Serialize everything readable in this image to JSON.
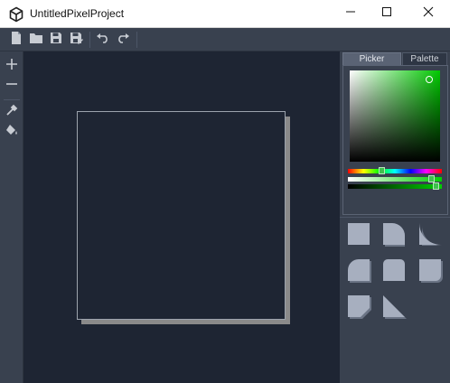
{
  "window": {
    "title": "UntitledPixelProject",
    "app_icon": "unity-logo-icon",
    "controls": [
      "minimize-icon",
      "maximize-icon",
      "close-icon"
    ]
  },
  "toolbar": {
    "buttons": [
      "new-file-icon",
      "open-folder-icon",
      "save-icon",
      "save-as-icon",
      "undo-icon",
      "redo-icon"
    ]
  },
  "left_tools": {
    "buttons": [
      "zoom-in-icon",
      "zoom-out-icon",
      "eyedropper-icon",
      "paint-bucket-icon"
    ]
  },
  "color_panel": {
    "tabs": [
      {
        "label": "Picker",
        "selected": true
      },
      {
        "label": "Palette",
        "selected": false
      }
    ],
    "current_color": "#00c800",
    "hue_slider_fraction": 0.36,
    "saturation_slider_fraction": 0.9,
    "value_slider_fraction": 0.9
  },
  "brush_shapes": [
    "square-shape",
    "rounded-top-right-shape",
    "concave-corner-shape",
    "rounded-top-left-shape",
    "small-rounded-shape",
    "rounded-bottom-right-shape",
    "cut-bottom-right-shape",
    "triangle-shape"
  ],
  "colors": {
    "titlebar_bg": "#ffffff",
    "toolbar_bg": "#39414f",
    "canvas_bg": "#1e2533",
    "icon": "#c8ccd3",
    "shape_fill": "#a7afbf"
  }
}
